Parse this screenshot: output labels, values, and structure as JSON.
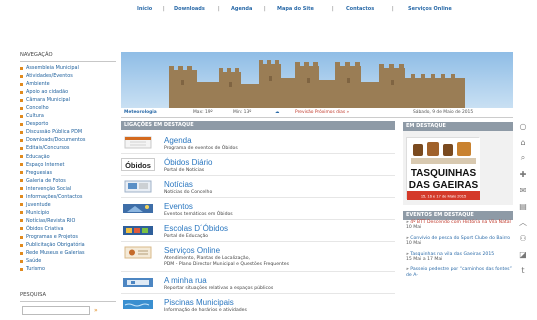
{
  "topnav": {
    "items": [
      "Início",
      "Downloads",
      "Agenda",
      "Mapa do Site",
      "Contactos",
      "Serviços Online"
    ],
    "separator": "|"
  },
  "sidebar": {
    "title": "NAVEGAÇÃO",
    "items": [
      "Assembleia Municipal",
      "Atividades/Eventos",
      "Ambiente",
      "Apoio ao cidadão",
      "Câmara Municipal",
      "Concelho",
      "Cultura",
      "Desporto",
      "Discussão Pública PDM",
      "Downloads/Documentos",
      "Editais/Concursos",
      "Educação",
      "Espaço Internet",
      "Freguesias",
      "Galeria de Fotos",
      "Intervenção Social",
      "Informações/Contactos",
      "Juventude",
      "Município",
      "Notícias/Revista RIO",
      "Óbidos Criativa",
      "Programas e Projetos",
      "Publicitação Obrigatória",
      "Rede Museus e Galerias",
      "Saúde",
      "Turismo"
    ],
    "search_title": "PESQUISA",
    "search_go": "»"
  },
  "weather": {
    "label": "Meteorologia",
    "max": "Max: 19º",
    "min": "Min: 13º",
    "next": "Previsão Próximos dias »",
    "date": "Sábado, 9 de Maio de 2015"
  },
  "links": {
    "header": "LIGAÇÕES EM DESTAQUE",
    "items": [
      {
        "title": "Agenda",
        "sub": [
          "Programa de eventos de Óbidos"
        ]
      },
      {
        "title": "Óbidos Diário",
        "sub": [
          "Portal de Notícias"
        ]
      },
      {
        "title": "Notícias",
        "sub": [
          "Notícias do Concelho"
        ]
      },
      {
        "title": "Eventos",
        "sub": [
          "Eventos temáticos em Óbidos"
        ]
      },
      {
        "title": "Escolas D´Óbidos",
        "sub": [
          "Portal de Educação"
        ]
      },
      {
        "title": "Serviços Online",
        "sub": [
          "Atendimento, Plantas de Localização,",
          "PDM - Plano Director Municipal e Questões Frequentes"
        ]
      },
      {
        "title": "A minha rua",
        "sub": [
          "Reportar situações relativas a espaços públicos"
        ]
      },
      {
        "title": "Piscinas Municipais",
        "sub": [
          "Informação de horários e atividades"
        ]
      }
    ],
    "icon_label_obidos": "Óbidos"
  },
  "feature": {
    "header": "EM DESTAQUE",
    "poster_title_1": "TASQUINHAS",
    "poster_title_2": "DAS GAEIRAS",
    "poster_dates": "15, 16 e 17 de Maio 2015"
  },
  "events": {
    "header": "EVENTOS EM DESTAQUE",
    "items": [
      {
        "title": "4º BTT Descendo com História na Vila Natal",
        "date": "10 Mai",
        "red": true
      },
      {
        "title": "Convívio de pesca do Sport Clube do Bairro",
        "date": "10 Mai",
        "red": false
      },
      {
        "title": "Tasquinhas na vila das Gaeiras 2015",
        "date": "15 Mai a 17 Mai",
        "red": false
      },
      {
        "title": "Passeio pedestre por “caminhos das fontes” de A-",
        "date": "",
        "red": false
      }
    ]
  },
  "colors": {
    "link_blue": "#2a77c0",
    "bullet_orange": "#e08a1e",
    "header_gray": "#8e9aa6",
    "event_red": "#c0392b"
  },
  "rail_icons": [
    "circle-icon",
    "home-icon",
    "search-icon",
    "plus-icon",
    "mail-icon",
    "print-icon",
    "up-icon",
    "people-icon",
    "rss-icon",
    "twitter-icon"
  ]
}
